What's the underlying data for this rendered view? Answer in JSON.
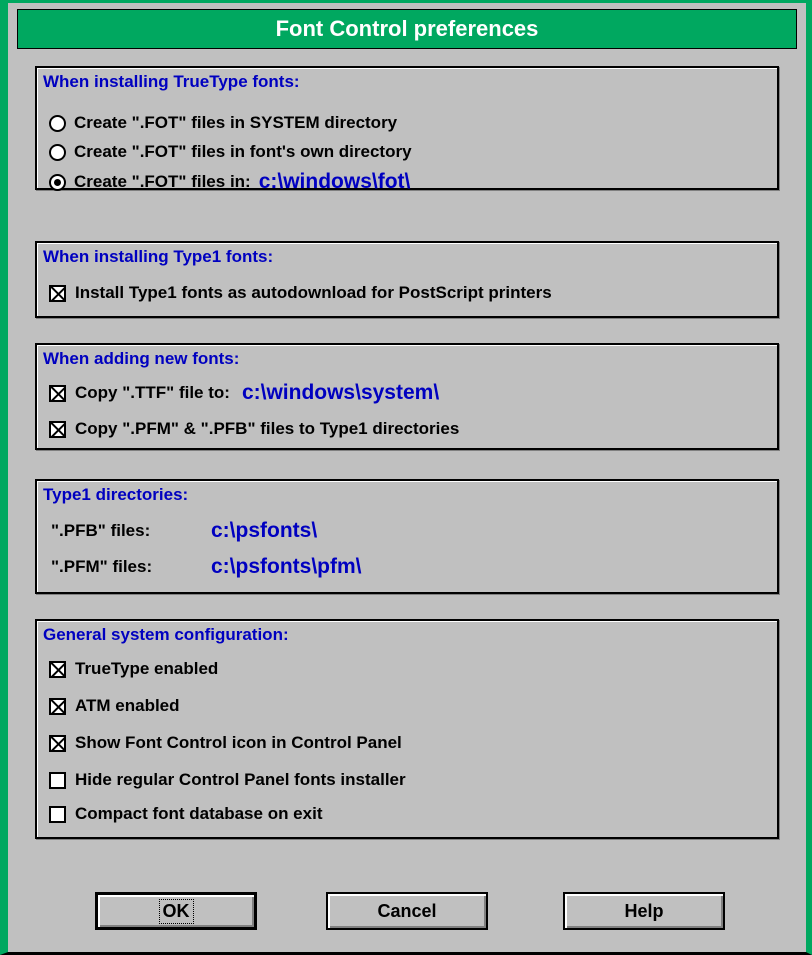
{
  "title": "Font Control preferences",
  "truetype": {
    "header": "When installing TrueType fonts:",
    "options": [
      {
        "label": "Create \".FOT\" files in SYSTEM directory",
        "selected": false
      },
      {
        "label": "Create \".FOT\" files in font's own directory",
        "selected": false
      },
      {
        "label": "Create \".FOT\" files in:",
        "selected": true,
        "path": "c:\\windows\\fot\\"
      }
    ]
  },
  "type1": {
    "header": "When installing Type1 fonts:",
    "autodownload_label": "Install Type1 fonts as autodownload for PostScript printers",
    "autodownload_checked": true
  },
  "adding": {
    "header": "When adding new fonts:",
    "copy_ttf_label": "Copy \".TTF\" file to:",
    "copy_ttf_path": "c:\\windows\\system\\",
    "copy_ttf_checked": true,
    "copy_pfm_label": "Copy \".PFM\" & \".PFB\" files to Type1 directories",
    "copy_pfm_checked": true
  },
  "type1_dirs": {
    "header": "Type1 directories:",
    "pfb_label": "\".PFB\" files:",
    "pfb_path": "c:\\psfonts\\",
    "pfm_label": "\".PFM\" files:",
    "pfm_path": "c:\\psfonts\\pfm\\"
  },
  "general": {
    "header": "General system configuration:",
    "items": [
      {
        "label": "TrueType enabled",
        "checked": true
      },
      {
        "label": "ATM enabled",
        "checked": true
      },
      {
        "label": "Show Font Control icon in Control Panel",
        "checked": true
      },
      {
        "label": "Hide regular Control Panel fonts installer",
        "checked": false
      },
      {
        "label": "Compact font database on exit",
        "checked": false
      }
    ]
  },
  "buttons": {
    "ok": "OK",
    "cancel": "Cancel",
    "help": "Help"
  },
  "colors": {
    "titlebar": "#00a860",
    "accent_text": "#0000c0",
    "dialog": "#c0c0c0"
  }
}
